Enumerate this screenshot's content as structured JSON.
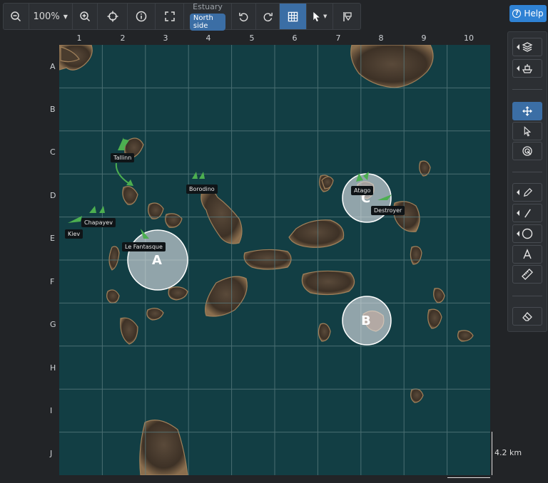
{
  "toolbar": {
    "zoom_level": "100%",
    "location_title": "Estuary",
    "location_sub": "North side"
  },
  "help": {
    "label": "Help"
  },
  "grid": {
    "columns": [
      "1",
      "2",
      "3",
      "4",
      "5",
      "6",
      "7",
      "8",
      "9",
      "10"
    ],
    "rows": [
      "A",
      "B",
      "C",
      "D",
      "E",
      "F",
      "G",
      "H",
      "I",
      "J"
    ]
  },
  "ships": {
    "tallinn": "Tallinn",
    "borodino": "Borodino",
    "chapayev": "Chapayev",
    "kiev": "Kiev",
    "le_fantasque": "Le Fantasque",
    "atago": "Atago",
    "destroyer": "Destroyer"
  },
  "caps": {
    "a": "A",
    "b": "B",
    "c": "C"
  },
  "scale": {
    "vertical": "4.2 km"
  },
  "colors": {
    "accent": "#3b6ea5",
    "help": "#2f82d4",
    "water": "#123e44",
    "ally": "#4caf50"
  }
}
